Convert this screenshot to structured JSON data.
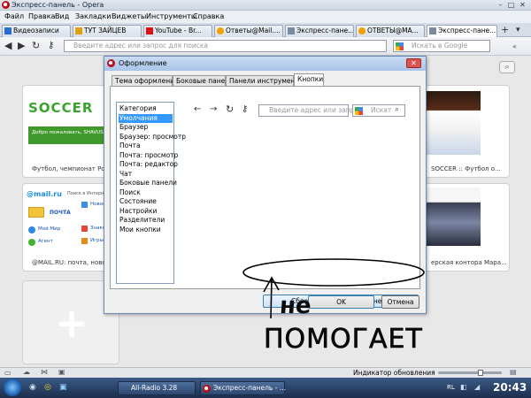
{
  "window": {
    "title": "Экспресс-панель - Opera"
  },
  "menu": [
    "Файл",
    "Правка",
    "Вид",
    "Закладки",
    "Виджеты",
    "Инструменты",
    "Справка"
  ],
  "tabs": [
    "Видеозаписи",
    "ТУТ ЗАЙЦЕВ",
    "YouTube - Br...",
    "Ответы@Mail....",
    "Экспресс-пане...",
    "ОТВЕТЫ@МА...",
    "Экспресс-пане..."
  ],
  "nav": {
    "address_placeholder": "Введите адрес или запрос для поиска",
    "search_placeholder": "Искать в Google"
  },
  "tiles": {
    "t1_caption": "Футбол, чемпионат Росс...",
    "t1_logo": "SOCCER",
    "t1_sub": "Добро пожаловать, SHAVUSH",
    "t2_caption": "@MAIL.RU: почта, новос...",
    "t2_logo": "@mail.ru",
    "t2_search": "Поиск в Интернете",
    "t2_links": [
      "ПОЧТА",
      "Мой Мир",
      "Агент",
      "Новости",
      "Знакомства",
      "Игры"
    ],
    "t3_caption": "SOCCER :: Футбол о...",
    "t4_caption": "ерская контора Мара..."
  },
  "dialog": {
    "title": "Оформление",
    "tabs": [
      "Тема оформления",
      "Боковые панели",
      "Панели инструментов",
      "Кнопки"
    ],
    "categories": [
      "Категория",
      "Умолчания",
      "Браузер",
      "Браузер: просмотр",
      "Почта",
      "Почта: просмотр",
      "Почта: редактор",
      "Чат",
      "Боковые панели",
      "Поиск",
      "Состояние",
      "Настройки",
      "Разделители",
      "Мои кнопки"
    ],
    "preview_address": "Введите адрес или запро",
    "preview_search": "Искат",
    "reset_button": "Сбросить настройки панели",
    "ok": "OK",
    "cancel": "Отмена"
  },
  "annotation": {
    "line1": "не",
    "line2": "ПОМОГАЕТ"
  },
  "statusbar": {
    "label": "Индикатор обновления"
  },
  "taskbar": {
    "apps": [
      "All-Radio 3.28",
      "Экспресс-панель - ..."
    ],
    "lang": "RL",
    "time": "20:43"
  }
}
